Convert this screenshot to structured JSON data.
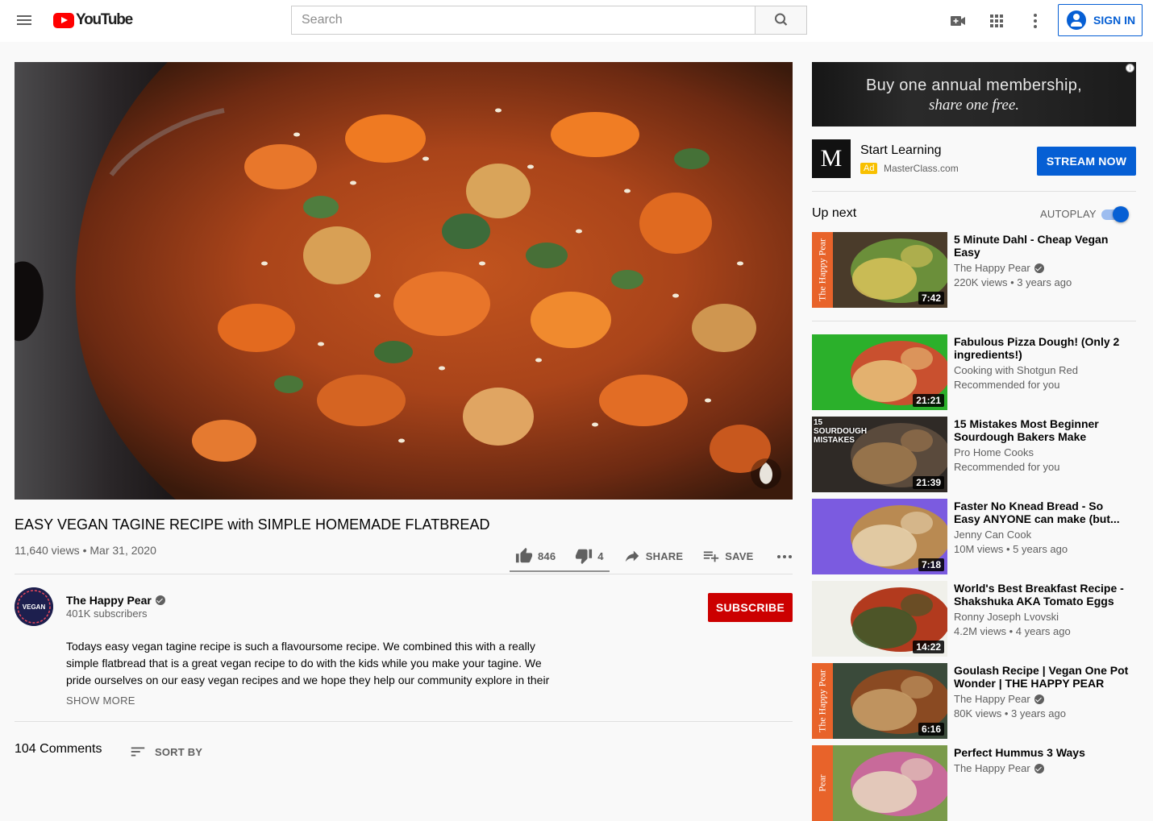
{
  "header": {
    "logo_text": "YouTube",
    "search_placeholder": "Search",
    "sign_in_label": "SIGN IN"
  },
  "video": {
    "title": "EASY VEGAN TAGINE RECIPE with SIMPLE HOMEMADE FLATBREAD",
    "views": "11,640 views",
    "date": "Mar 31, 2020",
    "likes": "846",
    "dislikes": "4",
    "share_label": "SHARE",
    "save_label": "SAVE"
  },
  "channel": {
    "name": "The Happy Pear",
    "subscribers": "401K subscribers",
    "subscribe_label": "SUBSCRIBE",
    "avatar_text": "VEGAN"
  },
  "description": {
    "text": "Todays easy vegan tagine recipe is such a flavoursome recipe. We combined this with a really simple flatbread that is a great vegan recipe to do with the kids while you make your tagine. We pride ourselves on our easy vegan recipes and we hope they help our community explore in their",
    "show_more_label": "SHOW MORE"
  },
  "comments": {
    "count_label": "104 Comments",
    "sort_label": "SORT BY"
  },
  "ad": {
    "banner_line1": "Buy one annual membership,",
    "banner_line2": "share one free.",
    "logo_letter": "M",
    "title": "Start Learning",
    "badge": "Ad",
    "domain": "MasterClass.com",
    "cta": "STREAM NOW"
  },
  "sidebar": {
    "up_next_label": "Up next",
    "autoplay_label": "AUTOPLAY",
    "autoplay_on": true
  },
  "recommendations": [
    {
      "title": "5 Minute Dahl - Cheap Vegan Easy",
      "channel": "The Happy Pear",
      "verified": true,
      "meta": "220K views • 3 years ago",
      "duration": "7:42",
      "thumb_text": "The Happy Pear",
      "colors": [
        "#6b8f3a",
        "#d9c35a",
        "#4a3b2a"
      ]
    },
    {
      "title": "Fabulous Pizza Dough! (Only 2 ingredients!)",
      "channel": "Cooking with Shotgun Red",
      "verified": false,
      "meta": "Recommended for you",
      "duration": "21:21",
      "thumb_text": "",
      "colors": [
        "#c9502f",
        "#e8c27a",
        "#2bb02b"
      ]
    },
    {
      "title": "15 Mistakes Most Beginner Sourdough Bakers Make",
      "channel": "Pro Home Cooks",
      "verified": false,
      "meta": "Recommended for you",
      "duration": "21:39",
      "thumb_text": "15 SOURDOUGH MISTAKES",
      "colors": [
        "#5a4a3c",
        "#a17a4e",
        "#2f2a26"
      ]
    },
    {
      "title": "Faster No Knead Bread - So Easy ANYONE can make (but...",
      "channel": "Jenny Can Cook",
      "verified": false,
      "meta": "10M views • 5 years ago",
      "duration": "7:18",
      "thumb_text": "",
      "colors": [
        "#b98a52",
        "#e8d4b0",
        "#7b5be0"
      ]
    },
    {
      "title": "World's Best Breakfast Recipe - Shakshuka AKA Tomato Eggs",
      "channel": "Ronny Joseph Lvovski",
      "verified": false,
      "meta": "4.2M views • 4 years ago",
      "duration": "14:22",
      "thumb_text": "",
      "colors": [
        "#b23a1e",
        "#3b5a2a",
        "#f0f0ea"
      ]
    },
    {
      "title": "Goulash Recipe | Vegan One Pot Wonder | THE HAPPY PEAR",
      "channel": "The Happy Pear",
      "verified": true,
      "meta": "80K views • 3 years ago",
      "duration": "6:16",
      "thumb_text": "The Happy Pear",
      "colors": [
        "#8a4a22",
        "#c8a06a",
        "#3a4a3a"
      ]
    },
    {
      "title": "Perfect Hummus 3 Ways",
      "channel": "The Happy Pear",
      "verified": true,
      "meta": "",
      "duration": "",
      "thumb_text": "Pear",
      "colors": [
        "#c86a9a",
        "#e8d8c0",
        "#7a9a4a"
      ]
    }
  ],
  "colors": {
    "brand_red": "#ff0000",
    "link_blue": "#065fd4",
    "subscribe_red": "#cc0000"
  }
}
